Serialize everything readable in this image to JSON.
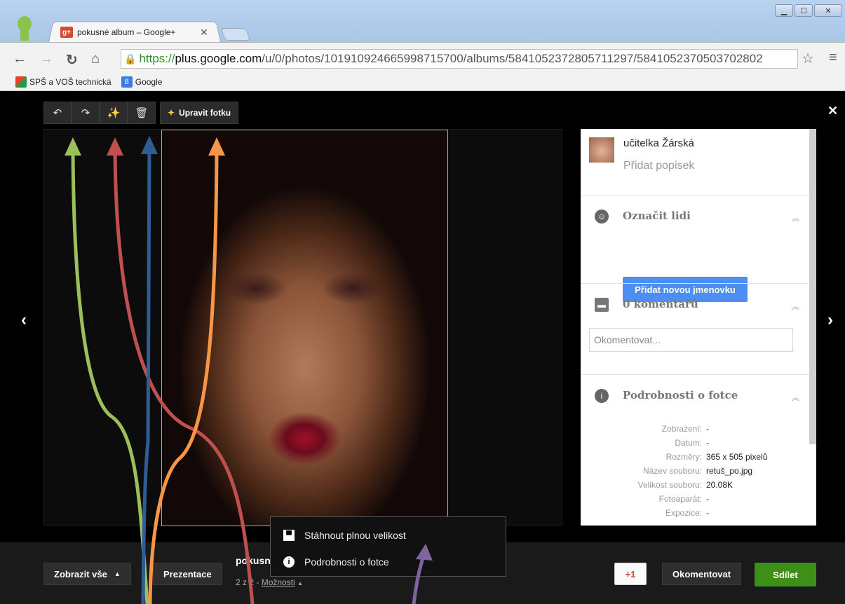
{
  "browser": {
    "tab_title": "pokusné album – Google+",
    "tab_favicon": "g+",
    "url_scheme": "https://",
    "url_host": "plus.google.com",
    "url_path": "/u/0/photos/101910924665998715700/albums/5841052372805711297/5841052370503702802",
    "bookmarks": [
      "SPŠ a VOŠ technická",
      "Google"
    ],
    "bookmark_google_icon": "8"
  },
  "viewer": {
    "edit_label": "Upravit fotku",
    "author": "učitelka Žárská",
    "caption_placeholder": "Přidat popisek",
    "tag_title": "Označit lidi",
    "tag_button": "Přidat novou jmenovku",
    "comments_title": "0 komentářů",
    "comment_placeholder": "Okomentovat...",
    "details_title": "Podrobnosti o fotce",
    "details": [
      {
        "label": "Zobrazení:",
        "value": "-"
      },
      {
        "label": "Datum:",
        "value": "-"
      },
      {
        "label": "Rozměry:",
        "value": "365 x 505 pixelů"
      },
      {
        "label": "Název souboru:",
        "value": "retuš_po.jpg"
      },
      {
        "label": "Velikost souboru:",
        "value": "20.08K"
      },
      {
        "label": "Fotoaparát:",
        "value": "-"
      },
      {
        "label": "Expozice:",
        "value": "-"
      }
    ]
  },
  "popup": {
    "download": "Stáhnout plnou velikost",
    "photo_details": "Podrobnosti o fotce"
  },
  "bottom": {
    "show_all": "Zobrazit vše",
    "slideshow": "Prezentace",
    "album_name": "pokusné album",
    "counter": "2 z 2",
    "separator": "-",
    "options": "Možnosti",
    "plus_one": "+1",
    "comment": "Okomentovat",
    "share": "Sdílet"
  },
  "annotation_colors": {
    "green": "#9bbf5a",
    "red": "#c0504d",
    "blue": "#2e5c93",
    "orange": "#f79646",
    "purple": "#8064a2"
  }
}
